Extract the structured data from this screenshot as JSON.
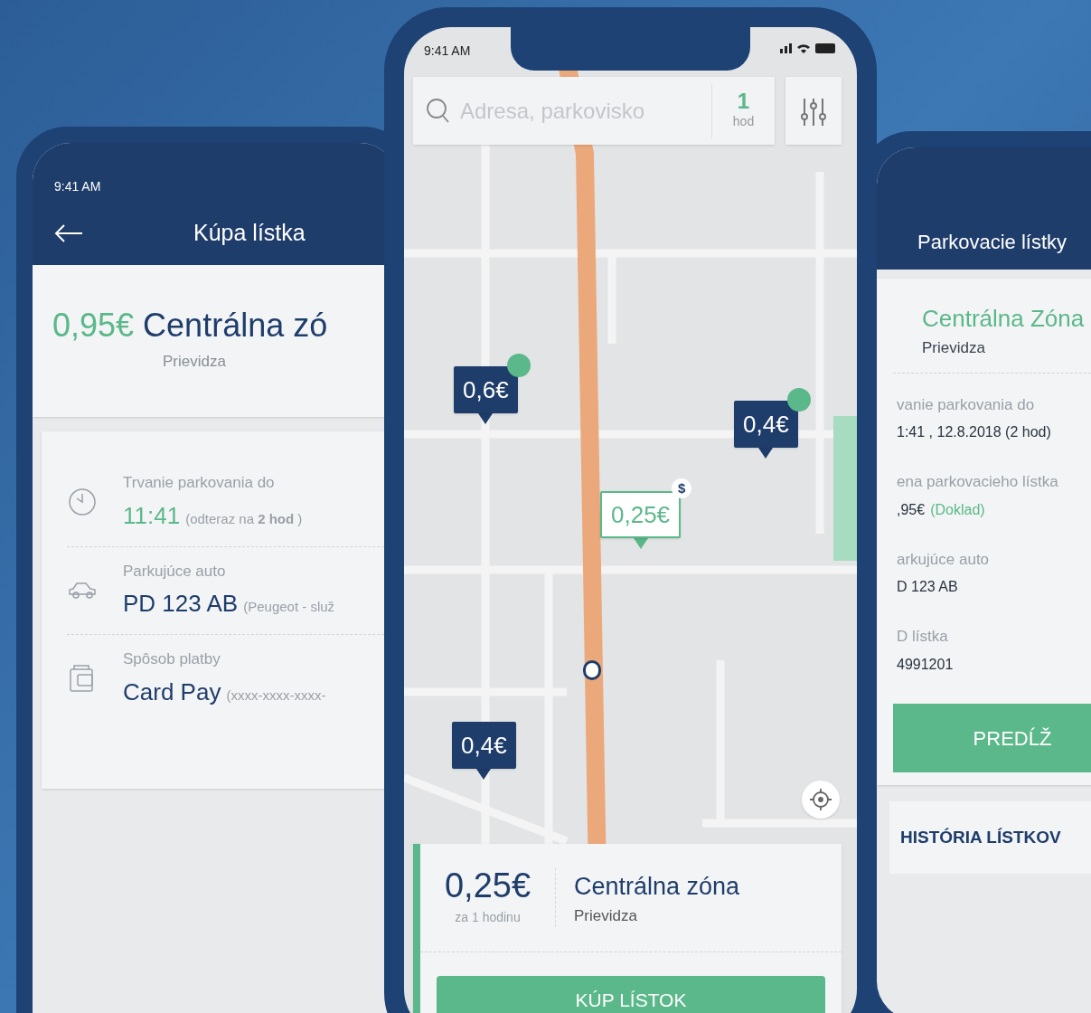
{
  "purchase_screen": {
    "status_time": "9:41 AM",
    "title": "Kúpa lístka",
    "zone": {
      "price": "0,95€",
      "name": "Centrálna zó",
      "city": "Prievidza"
    },
    "details": [
      {
        "kind": "time",
        "label": "Trvanie parkovania do",
        "value": "11:41",
        "note": "(odteraz na **2 hod** )"
      },
      {
        "kind": "car",
        "label": "Parkujúce auto",
        "value": "PD 123 AB",
        "note": "(Peugeot - služ"
      },
      {
        "kind": "payment",
        "label": "Spôsob platby",
        "value": "Card Pay",
        "note": "(xxxx-xxxx-xxxx-"
      }
    ]
  },
  "map_screen": {
    "status_time": "9:41 AM",
    "search": {
      "placeholder": "Adresa, parkovisko"
    },
    "duration": {
      "value": "1",
      "unit": "hod"
    },
    "markers": [
      {
        "price": "0,6€",
        "selected": false,
        "available": true
      },
      {
        "price": "0,4€",
        "selected": false,
        "available": true
      },
      {
        "price": "0,25€",
        "selected": true,
        "available": false,
        "badge": "$"
      },
      {
        "price": "0,4€",
        "selected": false,
        "available": false
      }
    ],
    "zone_card": {
      "price": "0,25€",
      "per": "za 1 hodinu",
      "name": "Centrálna zóna",
      "city": "Prievidza",
      "button": "KÚP LÍSTOK"
    }
  },
  "tickets_screen": {
    "title": "Parkovacie lístky",
    "ticket": {
      "zone": "Centrálna Zóna",
      "city": "Prievidza",
      "fields": [
        {
          "label": "vanie parkovania do",
          "value": "1:41 , 12.8.2018 (2 hod)"
        },
        {
          "label": "ena parkovacieho lístka",
          "value": ",95€",
          "link": "(Doklad)"
        },
        {
          "label": "arkujúce auto",
          "value": "D 123 AB"
        },
        {
          "label": "D lístka",
          "value": "4991201"
        }
      ]
    },
    "extend_button": "PREDĹŽ",
    "history_button": "HISTÓRIA LÍSTKOV"
  }
}
